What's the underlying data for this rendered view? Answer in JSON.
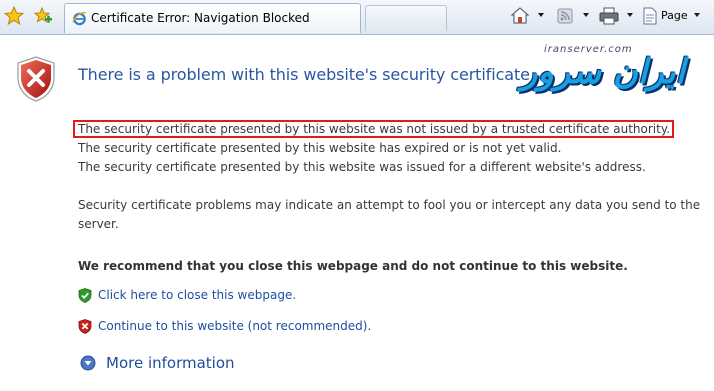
{
  "toolbar": {
    "tab_title": "Certificate Error: Navigation Blocked",
    "page_label": "Page",
    "icons": [
      "favorites-star-icon",
      "add-favorite-icon",
      "ie-logo-icon",
      "home-icon",
      "rss-feed-icon",
      "print-icon",
      "page-icon"
    ]
  },
  "content": {
    "heading": "There is a problem with this website's security certificate.",
    "logo_latin": "iranserver.com",
    "logo_persian": "ایران سرور",
    "reasons": [
      "The security certificate presented by this website was not issued by a trusted certificate authority.",
      "The security certificate presented by this website has expired or is not yet valid.",
      "The security certificate presented by this website was issued for a different website's address."
    ],
    "warning_line1": "Security certificate problems may indicate an attempt to fool you or intercept any data you send to the",
    "warning_line2": "server.",
    "recommend": "We recommend that you close this webpage and do not continue to this website.",
    "close_link": "Click here to close this webpage.",
    "continue_link": "Continue to this website (not recommended).",
    "more_info": "More information"
  },
  "colors": {
    "heading": "#2a56a1",
    "link": "#1f4d9e",
    "highlight_border": "#e31a1a",
    "shield_red": "#c8201e",
    "shield_green": "#2e9a2e"
  }
}
